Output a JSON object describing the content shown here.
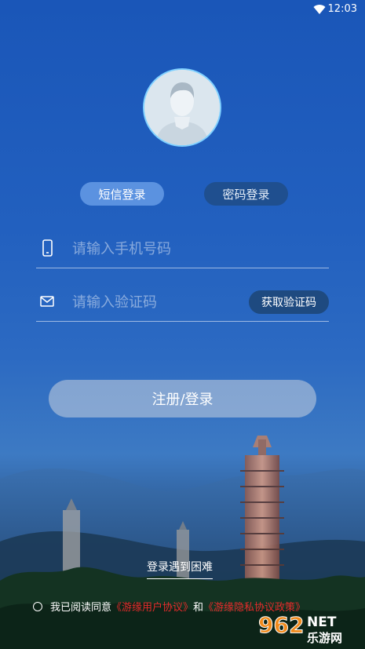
{
  "status_bar": {
    "time": "12:03"
  },
  "tabs": {
    "sms": "短信登录",
    "password": "密码登录"
  },
  "phone_field": {
    "placeholder": "请输入手机号码"
  },
  "code_field": {
    "placeholder": "请输入验证码",
    "get_code_label": "获取验证码"
  },
  "login_button": "注册/登录",
  "help_link": "登录遇到困难",
  "agreement": {
    "prefix": "我已阅读同意",
    "user_agreement": "《游缘用户协议》",
    "and": "和",
    "privacy_policy": "《游缘隐私协议政策》"
  },
  "watermark": {
    "brand": "962",
    "suffix": "NET",
    "site": "乐游网"
  }
}
